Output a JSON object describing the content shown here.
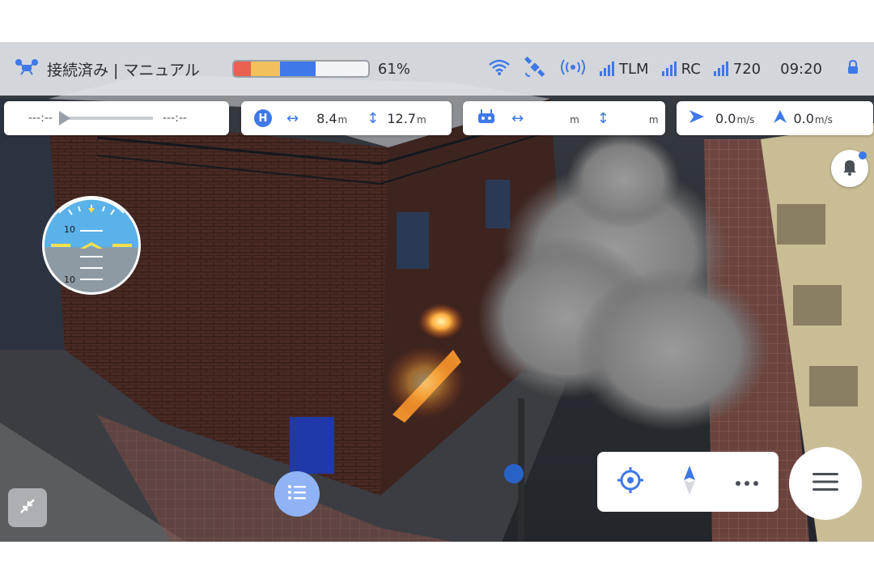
{
  "status": {
    "connection_label": "接続済み | マニュアル",
    "battery_percent_label": "61%",
    "battery_level": 0.61,
    "tlm_label": "TLM",
    "rc_label": "RC",
    "resolution_label": "720",
    "time_label": "09:20"
  },
  "playback": {
    "start_time": "---:--",
    "end_time": "---:--"
  },
  "home_distance": {
    "home_letter": "H",
    "horizontal_value": "8.4",
    "horizontal_unit": "m",
    "vertical_value": "12.7",
    "vertical_unit": "m"
  },
  "rc_distance": {
    "horizontal_value": "",
    "horizontal_unit": "m",
    "vertical_value": "",
    "vertical_unit": "m"
  },
  "speed": {
    "horizontal_value": "0.0",
    "horizontal_unit": "m/s",
    "vertical_value": "0.0",
    "vertical_unit": "m/s"
  },
  "attitude": {
    "pitch_label_top": "10",
    "pitch_label_bottom": "10"
  },
  "colors": {
    "accent": "#3f78e8",
    "battery_red": "#e8604f",
    "battery_yellow": "#f2c15b",
    "battery_blue": "#3f78e8"
  },
  "icons": {
    "drone": "drone-icon",
    "wifi": "wifi-icon",
    "satellite": "satellite-icon",
    "signal": "signal-icon",
    "lock": "lock-icon",
    "bell": "bell-icon",
    "target": "target-icon",
    "compass": "compass-icon",
    "more": "more-icon",
    "menu": "menu-icon",
    "list": "list-icon",
    "minimize": "minimize-icon"
  }
}
